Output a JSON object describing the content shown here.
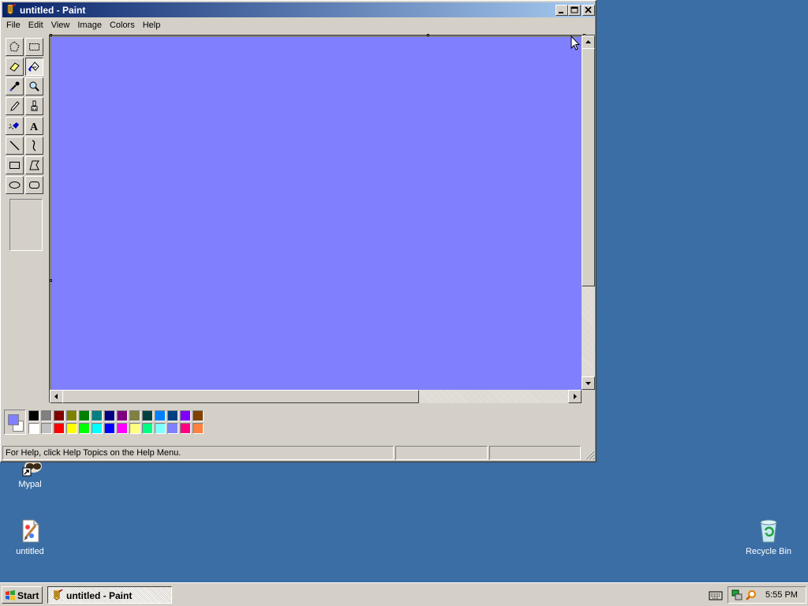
{
  "window": {
    "title": "untitled - Paint",
    "minimize_label": "_",
    "maximize_label": "□",
    "close_label": "✕"
  },
  "menu": [
    "File",
    "Edit",
    "View",
    "Image",
    "Colors",
    "Help"
  ],
  "tools": [
    {
      "name": "free-form-select",
      "icon": "free-select-icon"
    },
    {
      "name": "select",
      "icon": "rect-select-icon"
    },
    {
      "name": "eraser",
      "icon": "eraser-icon"
    },
    {
      "name": "fill-with-color",
      "icon": "fill-bucket-icon",
      "active": true
    },
    {
      "name": "pick-color",
      "icon": "eyedropper-icon"
    },
    {
      "name": "magnifier",
      "icon": "magnifier-icon"
    },
    {
      "name": "pencil",
      "icon": "pencil-icon"
    },
    {
      "name": "brush",
      "icon": "brush-icon"
    },
    {
      "name": "airbrush",
      "icon": "airbrush-icon"
    },
    {
      "name": "text",
      "icon": "text-icon"
    },
    {
      "name": "line",
      "icon": "line-icon"
    },
    {
      "name": "curve",
      "icon": "curve-icon"
    },
    {
      "name": "rectangle",
      "icon": "rectangle-icon"
    },
    {
      "name": "polygon",
      "icon": "polygon-icon"
    },
    {
      "name": "ellipse",
      "icon": "ellipse-icon"
    },
    {
      "name": "rounded-rectangle",
      "icon": "rounded-rect-icon"
    }
  ],
  "canvas": {
    "color": "#8080ff"
  },
  "colors": {
    "foreground": "#8080ff",
    "background": "#ffffff",
    "palette_top": [
      "#000000",
      "#808080",
      "#800000",
      "#808000",
      "#008000",
      "#008080",
      "#000080",
      "#800080",
      "#808040",
      "#004040",
      "#0080ff",
      "#004080",
      "#8000ff",
      "#804000"
    ],
    "palette_bottom": [
      "#ffffff",
      "#c0c0c0",
      "#ff0000",
      "#ffff00",
      "#00ff00",
      "#00ffff",
      "#0000ff",
      "#ff00ff",
      "#ffff80",
      "#00ff80",
      "#80ffff",
      "#8080ff",
      "#ff0080",
      "#ff8040"
    ]
  },
  "status": {
    "help_text": "For Help, click Help Topics on the Help Menu.",
    "position": "",
    "size": ""
  },
  "desktop": {
    "icons": [
      {
        "label": "Mypal",
        "icon": "mypal-icon"
      },
      {
        "label": "untitled",
        "icon": "paint-doc-icon"
      },
      {
        "label": "Recycle Bin",
        "icon": "recycle-bin-icon"
      }
    ]
  },
  "taskbar": {
    "start_label": "Start",
    "task_label": "untitled - Paint",
    "clock": "5:55 PM"
  }
}
